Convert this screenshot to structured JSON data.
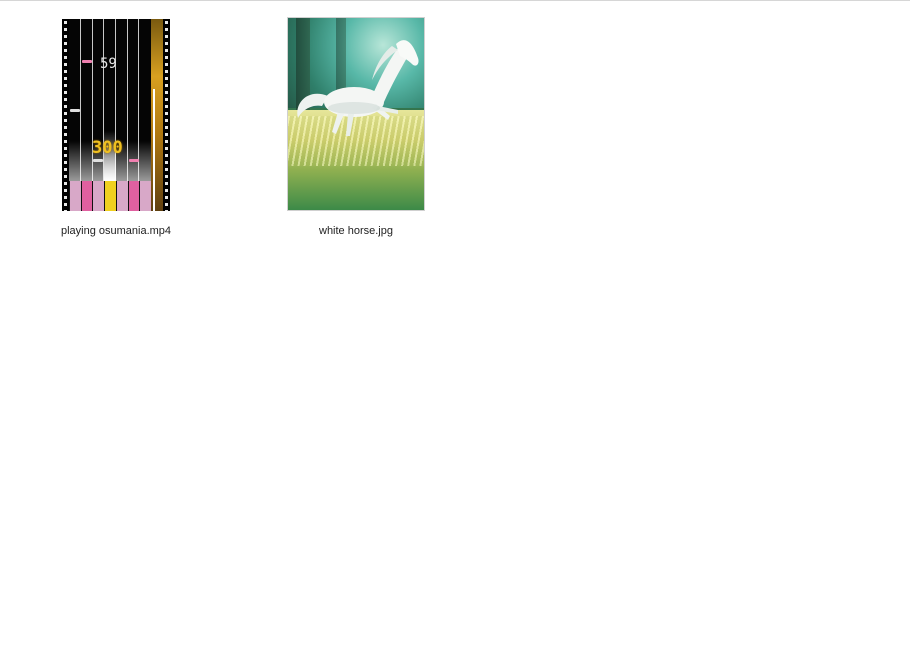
{
  "files": [
    {
      "name": "playing osumania.mp4",
      "type": "video",
      "thumbnail": {
        "combo": "59",
        "judgement": "300",
        "key_colors": [
          "#d8a8c8",
          "#e060a0",
          "#d8a8c8",
          "#f0d020",
          "#d8a8c8",
          "#e060a0",
          "#d8a8c8"
        ]
      }
    },
    {
      "name": "white horse.jpg",
      "type": "image"
    }
  ]
}
